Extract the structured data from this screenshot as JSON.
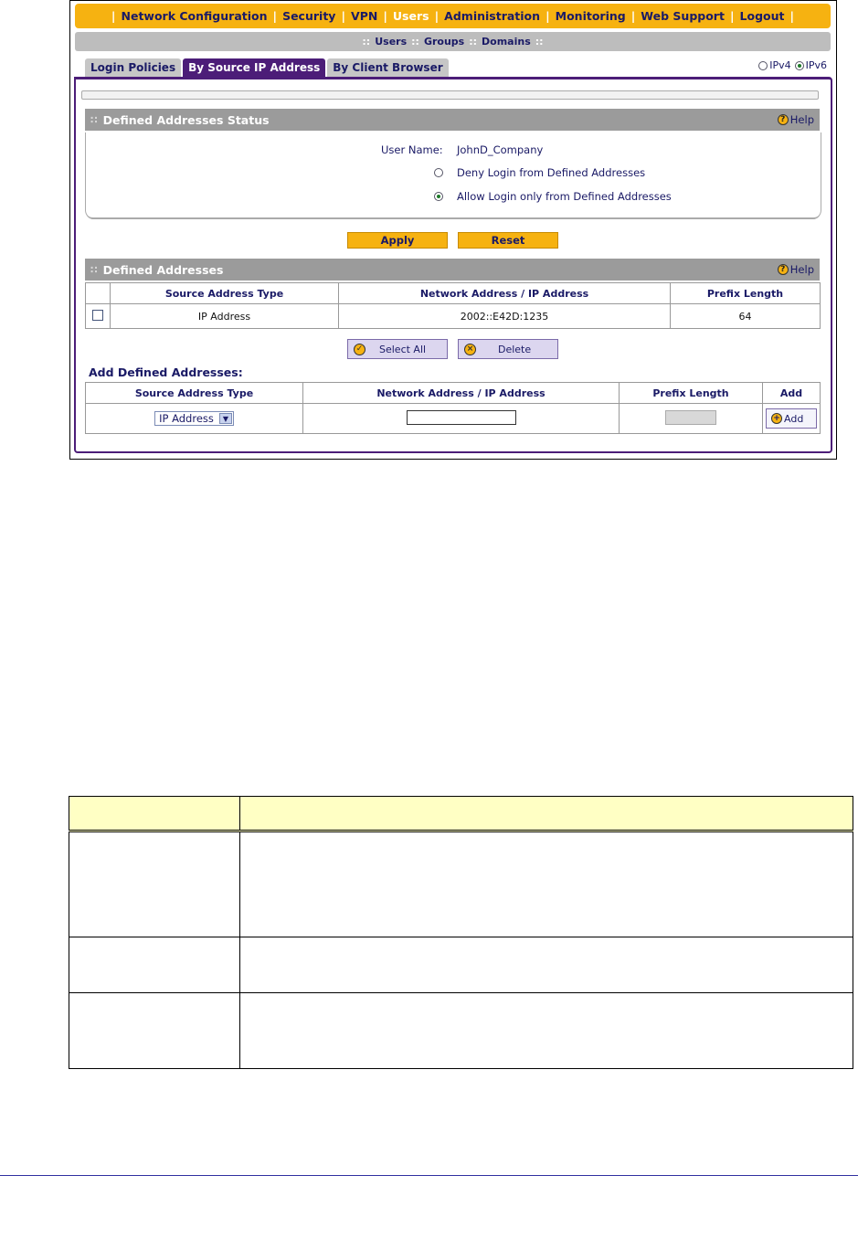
{
  "top_menu": [
    "Network Configuration",
    "Security",
    "VPN",
    "Users",
    "Administration",
    "Monitoring",
    "Web Support",
    "Logout"
  ],
  "top_menu_active": "Users",
  "sub_menu": [
    "Users",
    "Groups",
    "Domains"
  ],
  "tabs": [
    "Login Policies",
    "By Source IP Address",
    "By Client Browser"
  ],
  "tabs_active": "By Source IP Address",
  "ip_version": {
    "ipv4": "IPv4",
    "ipv6": "IPv6",
    "selected": "IPv6"
  },
  "status_section": {
    "title": "Defined Addresses Status",
    "help": "Help",
    "user_name_label": "User Name:",
    "user_name_value": "JohnD_Company",
    "options": [
      "Deny Login from Defined Addresses",
      "Allow Login only from Defined Addresses"
    ],
    "selected_option": "Allow Login only from Defined Addresses"
  },
  "buttons": {
    "apply": "Apply",
    "reset": "Reset",
    "select_all": "Select All",
    "delete": "Delete",
    "add": "Add"
  },
  "defined_section": {
    "title": "Defined Addresses",
    "help": "Help",
    "columns": [
      "Source Address Type",
      "Network Address / IP Address",
      "Prefix Length"
    ],
    "rows": [
      {
        "type": "IP Address",
        "address": "2002::E42D:1235",
        "prefix": "64",
        "checked": false
      }
    ]
  },
  "add_section": {
    "title": "Add Defined Addresses:",
    "columns": [
      "Source Address Type",
      "Network Address / IP Address",
      "Prefix Length",
      "Add"
    ],
    "type_selected": "IP Address",
    "address_value": "",
    "prefix_value": ""
  },
  "colors": {
    "accent": "#f6b211",
    "tab_active": "#4c1d78",
    "header_gray": "#9b9b9b",
    "doc_header": "#ffffc4"
  }
}
